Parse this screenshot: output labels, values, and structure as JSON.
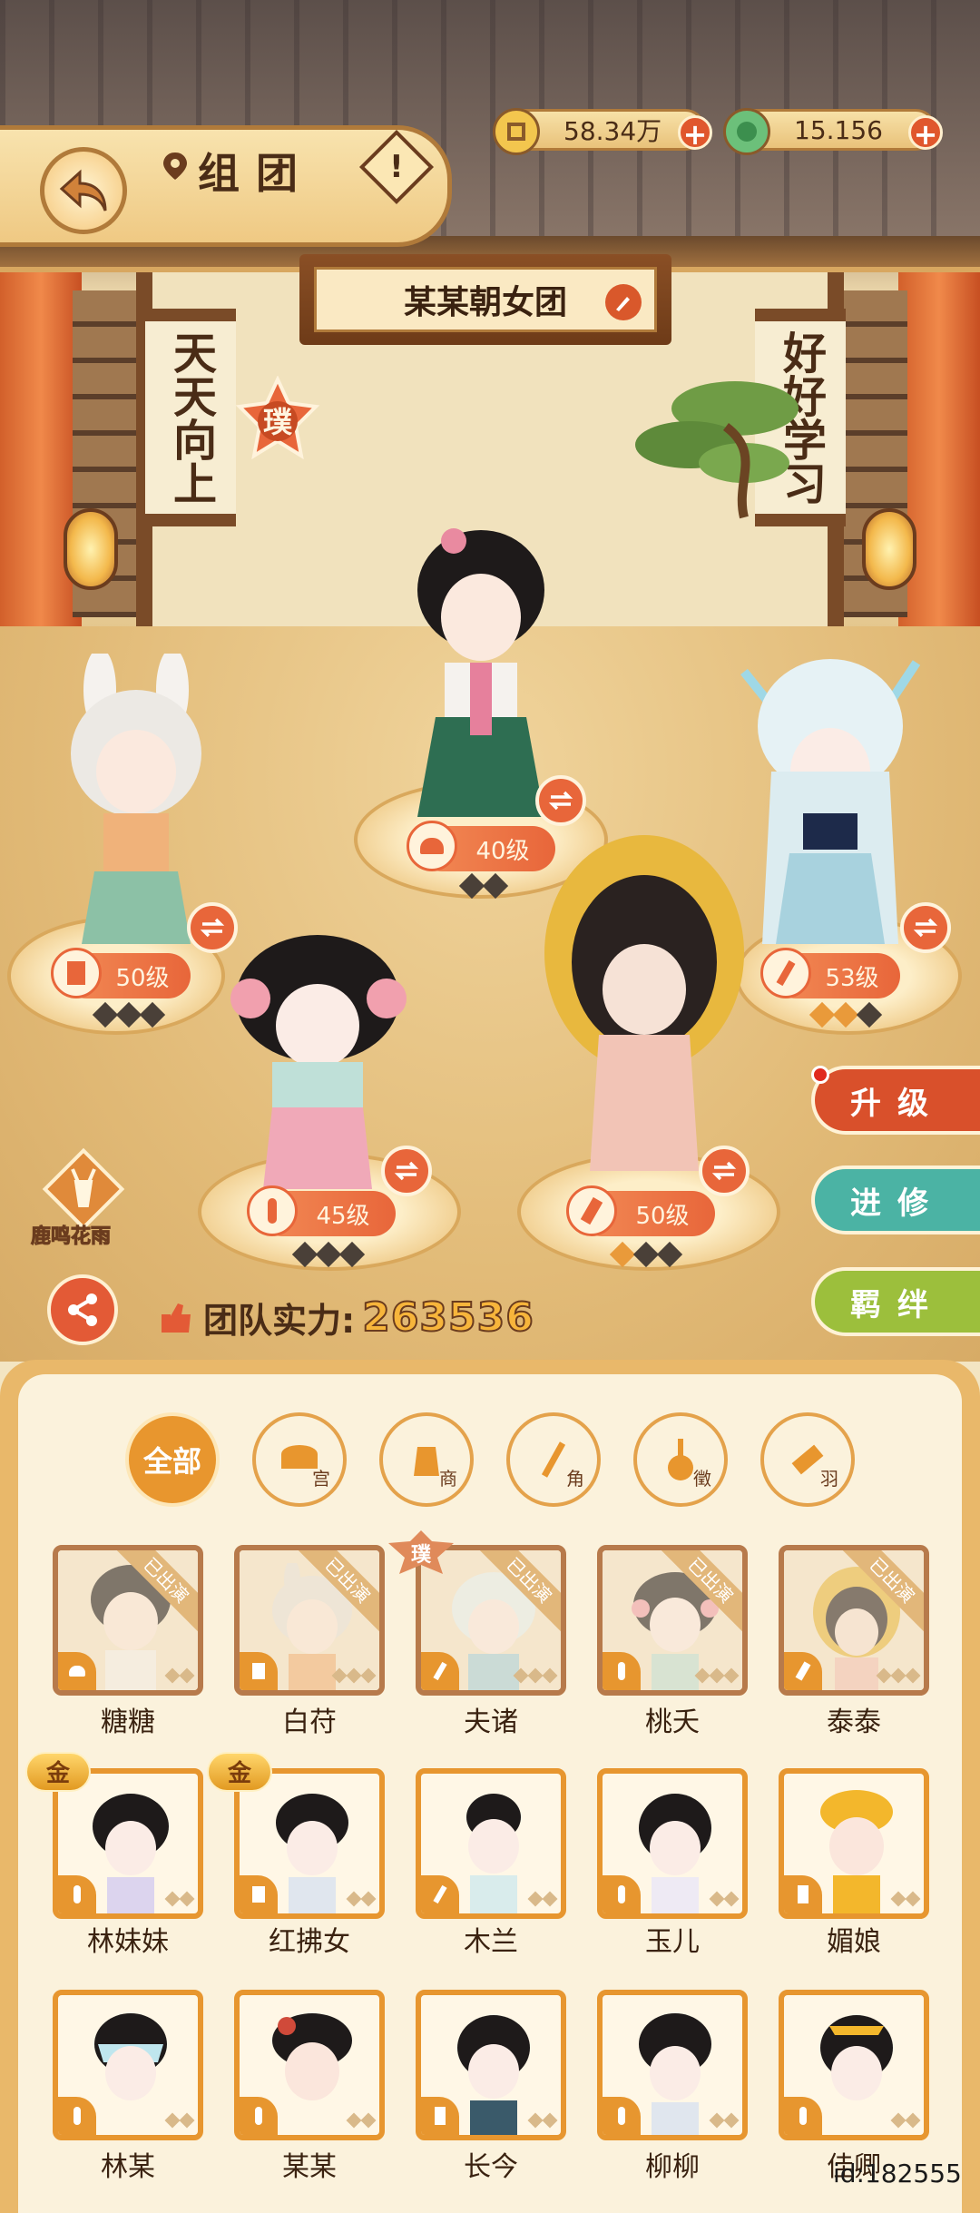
{
  "header": {
    "title": "组团",
    "help_label": "!",
    "coins": "58.34万",
    "jade": "15.156"
  },
  "team": {
    "name": "某某朝女团",
    "badge": "璞",
    "power_label": "团队实力:",
    "power_value": "263536"
  },
  "scrolls": {
    "left": "天天向上",
    "right": "好好学习"
  },
  "stage": [
    {
      "level": "40级",
      "stars_gold": 0,
      "stars_total": 2
    },
    {
      "level": "50级",
      "stars_gold": 0,
      "stars_total": 3
    },
    {
      "level": "53级",
      "stars_gold": 2,
      "stars_total": 3
    },
    {
      "level": "45级",
      "stars_gold": 0,
      "stars_total": 3
    },
    {
      "level": "50级",
      "stars_gold": 1,
      "stars_total": 3
    }
  ],
  "side_buttons": {
    "upgrade": "升级",
    "advance": "进修",
    "bond": "羁绊"
  },
  "deer_badge": {
    "label": "鹿鸣花雨"
  },
  "filters": {
    "all": "全部",
    "gong": "宫",
    "shang": "商",
    "jue": "角",
    "zhi": "徵",
    "yu": "羽"
  },
  "cards": {
    "performed_label": "已出演",
    "gold_label": "金",
    "pu_label": "璞",
    "row1": [
      "糖糖",
      "白苻",
      "夫诸",
      "桃夭",
      "泰泰"
    ],
    "row2": [
      "林妹妹",
      "红拂女",
      "木兰",
      "玉儿",
      "媚娘"
    ],
    "row3": [
      "林某",
      "某某",
      "长今",
      "柳柳",
      "佳卿"
    ]
  },
  "user_id": "id:182555",
  "colors": {
    "accent_orange": "#e8663a",
    "upgrade_red": "#d9502b",
    "advance_teal": "#4bb3a4",
    "bond_green": "#9cbf3c",
    "power_gold": "#f7b53b"
  }
}
